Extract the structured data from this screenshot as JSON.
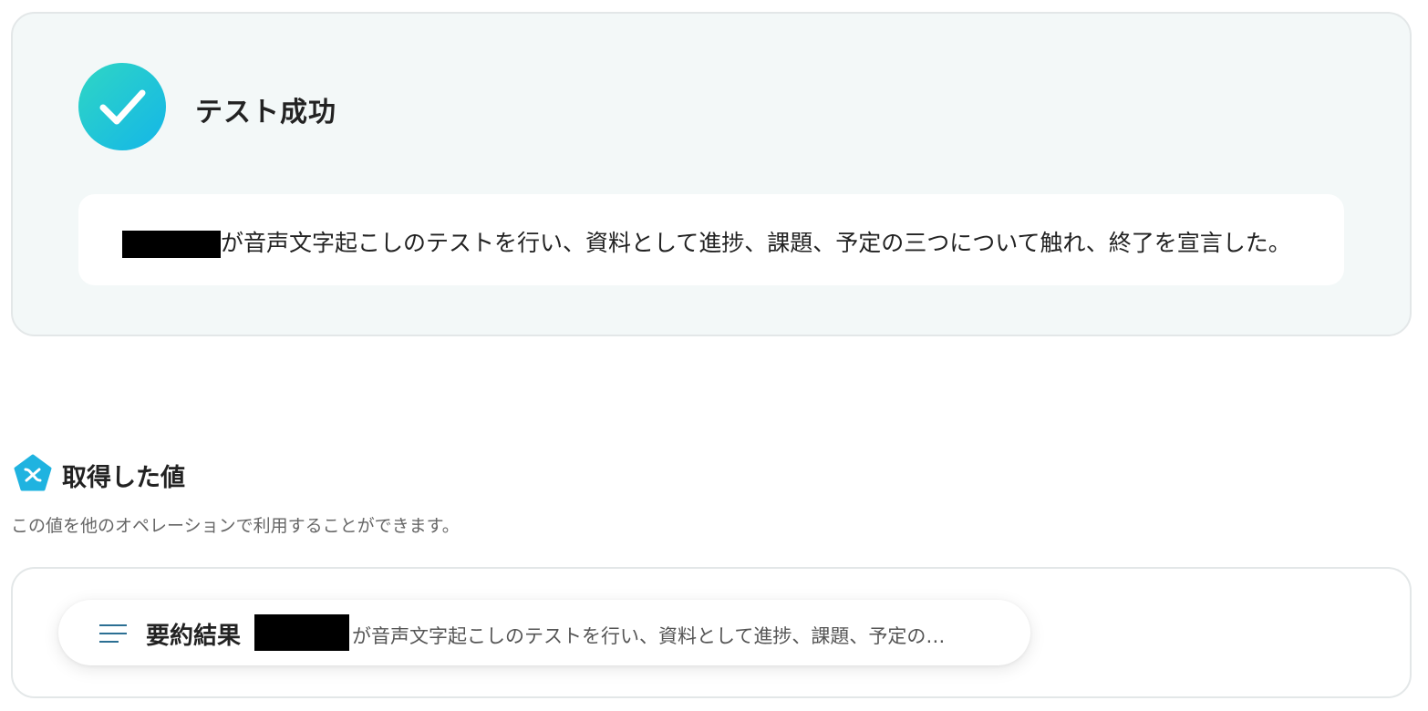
{
  "test_result": {
    "status_title": "テスト成功",
    "status_icon": "check-circle-icon",
    "output_text": "が音声文字起こしのテストを行い、資料として進捗、課題、予定の三つについて触れ、終了を宣言した。"
  },
  "obtained_values": {
    "section_icon": "variable-icon",
    "title": "取得した値",
    "description": "この値を他のオペレーションで利用することができます。",
    "items": [
      {
        "icon": "text-lines-icon",
        "key": "要約結果",
        "value_preview": "が音声文字起こしのテストを行い、資料として進捗、課題、予定の…"
      }
    ]
  },
  "colors": {
    "accent_gradient_start": "#2fd6c4",
    "accent_gradient_end": "#14b6e8",
    "card_background": "#f3f8f8",
    "section_icon": "#1fb3e0"
  }
}
